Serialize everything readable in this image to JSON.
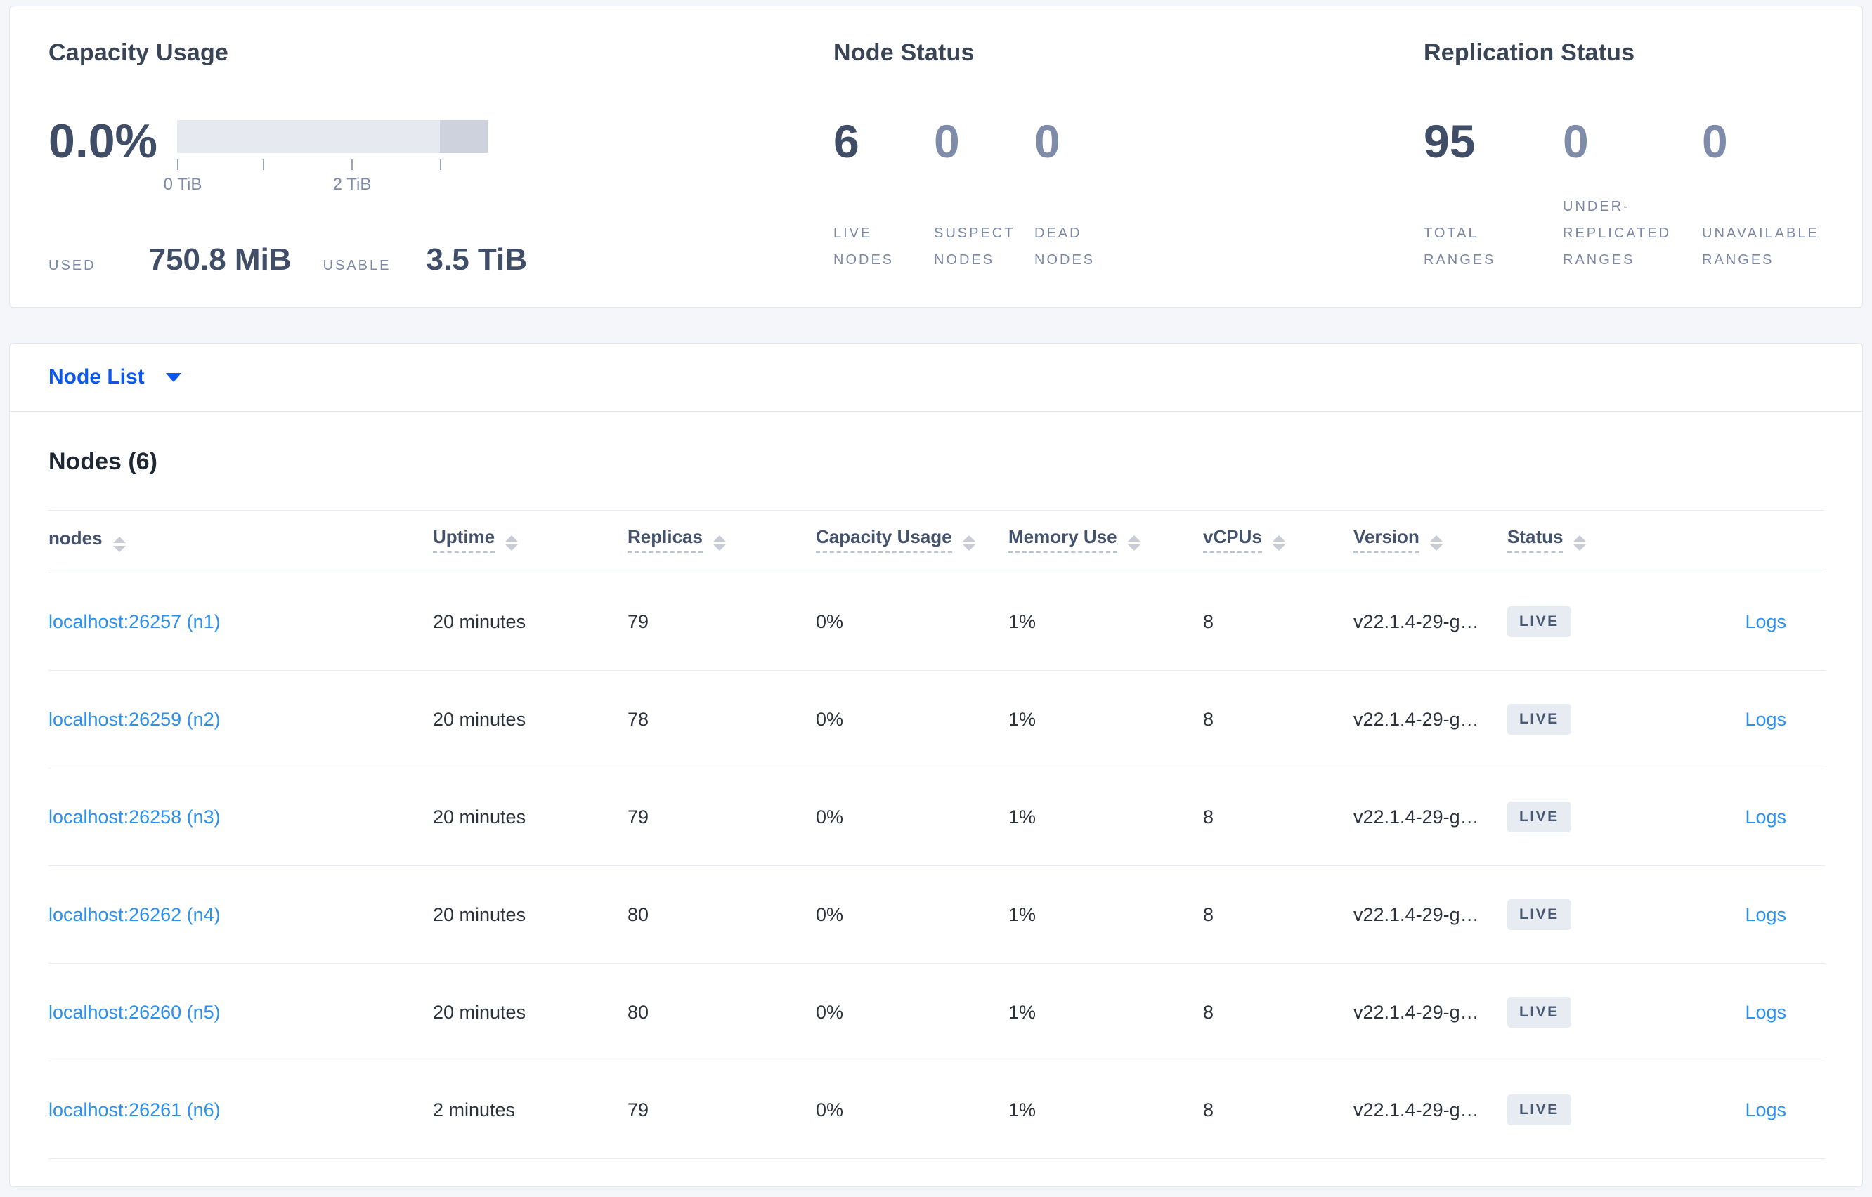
{
  "summary": {
    "capacity": {
      "title": "Capacity Usage",
      "percent": "0.0%",
      "used_label": "USED",
      "used_value": "750.8 MiB",
      "usable_label": "USABLE",
      "usable_value": "3.5 TiB",
      "tick_label_0": "0 TiB",
      "tick_label_2": "2 TiB"
    },
    "node_status": {
      "title": "Node Status",
      "stats": [
        {
          "value": "6",
          "label": "LIVE NODES"
        },
        {
          "value": "0",
          "label": "SUSPECT NODES"
        },
        {
          "value": "0",
          "label": "DEAD NODES"
        }
      ]
    },
    "replication": {
      "title": "Replication Status",
      "stats": [
        {
          "value": "95",
          "label": "TOTAL RANGES"
        },
        {
          "value": "0",
          "label": "UNDER-REPLICATED RANGES"
        },
        {
          "value": "0",
          "label": "UNAVAILABLE RANGES"
        }
      ]
    }
  },
  "node_list_dropdown": {
    "label": "Node List"
  },
  "table": {
    "title": "Nodes (6)",
    "columns": [
      {
        "label": "nodes"
      },
      {
        "label": "Uptime"
      },
      {
        "label": "Replicas"
      },
      {
        "label": "Capacity Usage"
      },
      {
        "label": "Memory Use"
      },
      {
        "label": "vCPUs"
      },
      {
        "label": "Version"
      },
      {
        "label": "Status"
      }
    ],
    "logs_label": "Logs",
    "rows": [
      {
        "name": "localhost:26257 (n1)",
        "uptime": "20 minutes",
        "replicas": "79",
        "capacity": "0%",
        "memory": "1%",
        "vcpus": "8",
        "version": "v22.1.4-29-g…",
        "status": "LIVE"
      },
      {
        "name": "localhost:26259 (n2)",
        "uptime": "20 minutes",
        "replicas": "78",
        "capacity": "0%",
        "memory": "1%",
        "vcpus": "8",
        "version": "v22.1.4-29-g…",
        "status": "LIVE"
      },
      {
        "name": "localhost:26258 (n3)",
        "uptime": "20 minutes",
        "replicas": "79",
        "capacity": "0%",
        "memory": "1%",
        "vcpus": "8",
        "version": "v22.1.4-29-g…",
        "status": "LIVE"
      },
      {
        "name": "localhost:26262 (n4)",
        "uptime": "20 minutes",
        "replicas": "80",
        "capacity": "0%",
        "memory": "1%",
        "vcpus": "8",
        "version": "v22.1.4-29-g…",
        "status": "LIVE"
      },
      {
        "name": "localhost:26260 (n5)",
        "uptime": "20 minutes",
        "replicas": "80",
        "capacity": "0%",
        "memory": "1%",
        "vcpus": "8",
        "version": "v22.1.4-29-g…",
        "status": "LIVE"
      },
      {
        "name": "localhost:26261 (n6)",
        "uptime": "2 minutes",
        "replicas": "79",
        "capacity": "0%",
        "memory": "1%",
        "vcpus": "8",
        "version": "v22.1.4-29-g…",
        "status": "LIVE"
      }
    ]
  },
  "colors": {
    "accent_blue": "#0b56f0",
    "link_blue": "#2b90f0",
    "heading_slate": "#394455",
    "muted_label": "#7b87a3",
    "badge_bg": "#e7ebf2",
    "bar_light": "#e7e9f0",
    "bar_dark": "#ced2dd",
    "page_bg": "#f4f6fa"
  }
}
